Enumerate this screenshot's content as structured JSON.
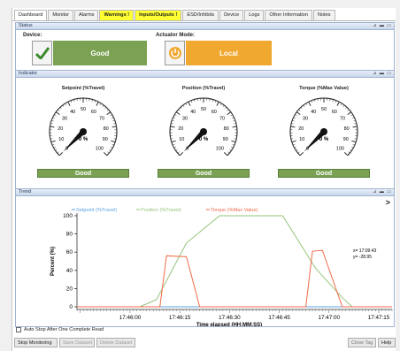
{
  "tabs": [
    {
      "label": "Dashboard",
      "state": "active"
    },
    {
      "label": "Monitor",
      "state": "normal"
    },
    {
      "label": "Alarms",
      "state": "normal"
    },
    {
      "label": "Warnings !",
      "state": "warning"
    },
    {
      "label": "Inputs/Outputs !",
      "state": "warning"
    },
    {
      "label": "ESD/Inhibits",
      "state": "normal"
    },
    {
      "label": "Device",
      "state": "normal"
    },
    {
      "label": "Logs",
      "state": "normal"
    },
    {
      "label": "Other Information",
      "state": "normal"
    },
    {
      "label": "Notes",
      "state": "normal"
    }
  ],
  "status": {
    "title": "Status",
    "device_label": "Device:",
    "device_value": "Good",
    "actuator_label": "Actuator Mode:",
    "actuator_value": "Local",
    "icons": {
      "device": "checkmark-icon",
      "actuator": "power-icon"
    },
    "colors": {
      "good": "#7aa252",
      "local": "#f0a830"
    }
  },
  "indicator": {
    "title": "Indicator",
    "gauges": [
      {
        "title": "Setpoint (%Travel)",
        "value": 0,
        "readout": "0 %",
        "status": "Good"
      },
      {
        "title": "Position (%Travel)",
        "value": 0,
        "readout": "0 %",
        "status": "Good"
      },
      {
        "title": "Torque (%Max Value)",
        "value": 0,
        "readout": "0 %",
        "status": "Good"
      }
    ],
    "scale_labels": [
      "0",
      "10",
      "20",
      "30",
      "40",
      "50",
      "60",
      "70",
      "80",
      "90",
      "100"
    ]
  },
  "trend": {
    "title": "Trend",
    "arrow": ">",
    "readout_x": "x= 17:09:43",
    "readout_y": "y= -28.95",
    "auto_stop_label": "Auto Stop After One Complete Read",
    "auto_stop_checked": false
  },
  "chart_data": {
    "type": "line",
    "xlabel": "Time elapsed (HH:MM:SS)",
    "ylabel": "Percent (%)",
    "ylim": [
      0,
      100
    ],
    "yticks": [
      0,
      20,
      40,
      60,
      80,
      100
    ],
    "xlim": [
      "17:45:44",
      "17:47:19"
    ],
    "xticks": [
      "17:46:00",
      "17:46:15",
      "17:46:30",
      "17:46:45",
      "17:47:00",
      "17:47:15"
    ],
    "grid": false,
    "legend_position": "top",
    "series": [
      {
        "name": "Setpoint (%Travel)",
        "color": "#5aa0e0",
        "points": [
          [
            "17:45:44",
            0
          ],
          [
            "17:47:19",
            0
          ]
        ]
      },
      {
        "name": "Position (%Travel)",
        "color": "#94c47a",
        "points": [
          [
            "17:45:44",
            0
          ],
          [
            "17:46:03",
            0
          ],
          [
            "17:46:08",
            8
          ],
          [
            "17:46:17",
            70
          ],
          [
            "17:46:27",
            100
          ],
          [
            "17:46:46",
            100
          ],
          [
            "17:46:56",
            42
          ],
          [
            "17:47:04",
            10
          ],
          [
            "17:47:07",
            0
          ],
          [
            "17:47:19",
            0
          ]
        ]
      },
      {
        "name": "Torque (%Max Value)",
        "color": "#f06a48",
        "points": [
          [
            "17:45:44",
            0
          ],
          [
            "17:46:09",
            0
          ],
          [
            "17:46:11",
            56
          ],
          [
            "17:46:17",
            55
          ],
          [
            "17:46:21",
            0
          ],
          [
            "17:46:53",
            0
          ],
          [
            "17:46:55",
            61
          ],
          [
            "17:46:58",
            62
          ],
          [
            "17:47:04",
            0
          ],
          [
            "17:47:19",
            0
          ]
        ]
      }
    ]
  },
  "buttons": {
    "stop": "Stop Monitoring",
    "save": "Save Dataset",
    "delete": "Delete Dataset",
    "close": "Close Tag",
    "help": "Help"
  }
}
